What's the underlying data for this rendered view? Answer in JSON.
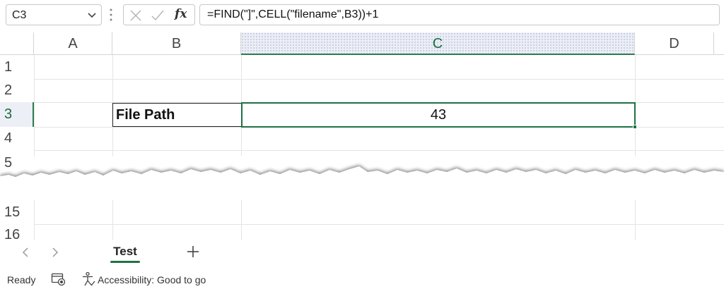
{
  "formula_bar": {
    "name_box": "C3",
    "fx_label": "fx",
    "formula": "=FIND(\"]\",CELL(\"filename\",B3))+1"
  },
  "columns": [
    "A",
    "B",
    "C",
    "D"
  ],
  "rows": [
    "1",
    "2",
    "3",
    "4",
    "5",
    "15",
    "16"
  ],
  "cells": {
    "B3": "File Path",
    "C3": "43"
  },
  "sheet_tabs": {
    "active": "Test",
    "add_label": "+"
  },
  "status_bar": {
    "ready": "Ready",
    "accessibility": "Accessibility: Good to go"
  },
  "colors": {
    "accent": "#1f7144",
    "selected_header": "#eceff6",
    "gridline": "#e4e4e4"
  }
}
